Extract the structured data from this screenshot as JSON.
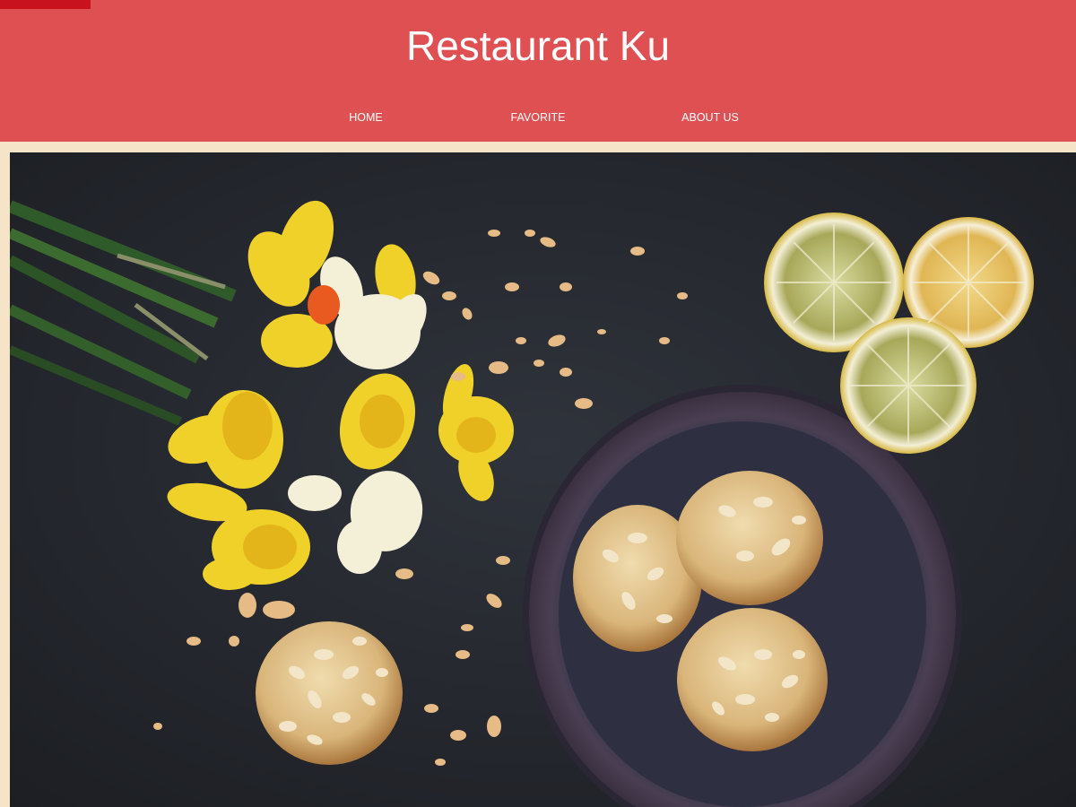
{
  "header": {
    "title": "Restaurant Ku",
    "background_color": "#df5052",
    "accent_color": "#c8121d"
  },
  "nav": {
    "items": [
      {
        "label": "HOME"
      },
      {
        "label": "FAVORITE"
      },
      {
        "label": "ABOUT US"
      }
    ]
  },
  "hero": {
    "image_alt": "Daffodils, almond cookies in a bowl and lemon slices on a dark table",
    "icons": [
      "daffodil-bouquet",
      "cookie-bowl",
      "lemon-slices",
      "almond-crumbs"
    ]
  },
  "page_background": "#f5e4c8"
}
